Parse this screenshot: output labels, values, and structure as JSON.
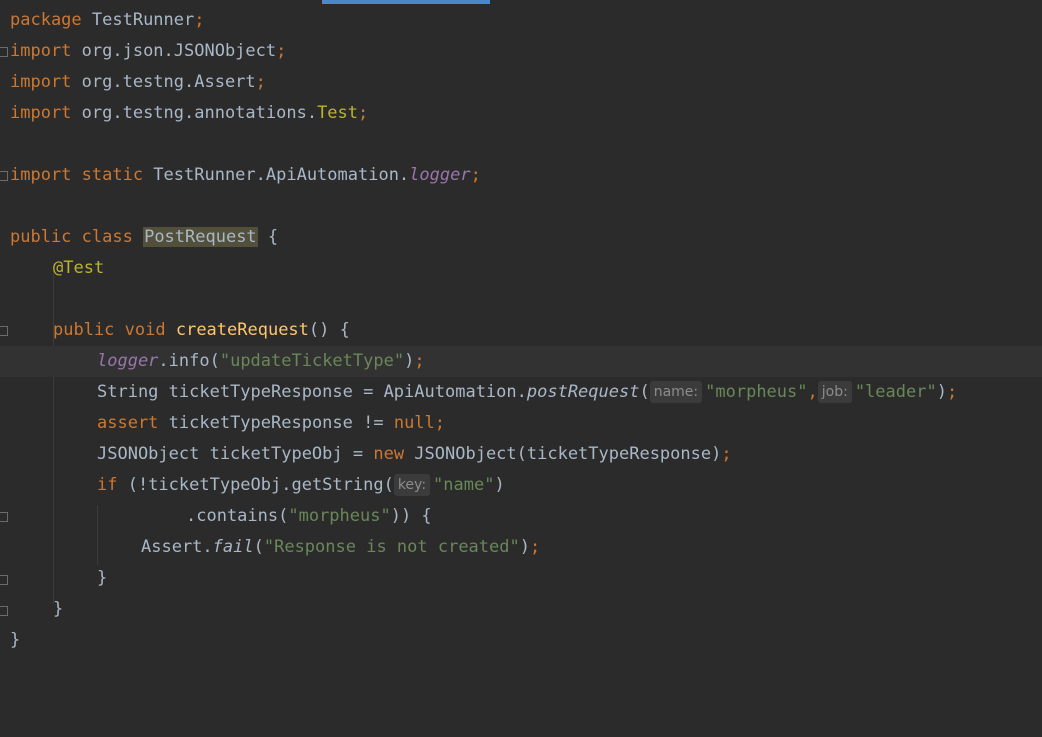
{
  "lines": {
    "l1": {
      "kw": "package",
      "rest": " TestRunner",
      "semi": ";"
    },
    "l2": {
      "kw": "import",
      "rest": " org.json.JSONObject",
      "semi": ";"
    },
    "l3": {
      "kw": "import",
      "rest": " org.testng.Assert",
      "semi": ";"
    },
    "l4": {
      "kw": "import",
      "rest": " org.testng.annotations.",
      "ann": "Test",
      "semi": ";"
    },
    "l6": {
      "kw": "import static",
      "rest": " TestRunner.ApiAutomation.",
      "field": "logger",
      "semi": ";"
    },
    "l8": {
      "kw": "public class",
      "space": " ",
      "cls": "PostRequest",
      "rest": " {"
    },
    "l9": {
      "ann": "@Test"
    },
    "l11": {
      "kw": "public void",
      "space": " ",
      "meth": "createRequest",
      "rest": "() {"
    },
    "l12": {
      "field": "logger",
      "a": ".info(",
      "str": "\"updateTicketType\"",
      "b": ")",
      "semi": ";"
    },
    "l13": {
      "a": "String ticketTypeResponse = ApiAutomation.",
      "call": "postRequest",
      "b": "(",
      "hint1": "name:",
      "str1": "\"morpheus\"",
      "comma": ",",
      "hint2": "job:",
      "str2": "\"leader\"",
      "c": ")",
      "semi": ";"
    },
    "l14": {
      "kw": "assert",
      "a": " ticketTypeResponse != ",
      "kw2": "null",
      "semi": ";"
    },
    "l15": {
      "a": "JSONObject ticketTypeObj = ",
      "kw": "new",
      "b": " JSONObject(ticketTypeResponse)",
      "semi": ";"
    },
    "l16": {
      "kw": "if",
      "a": " (!ticketTypeObj.getString(",
      "hint": "key:",
      "str": "\"name\"",
      "b": ")"
    },
    "l17": {
      "a": ".contains(",
      "str": "\"morpheus\"",
      "b": ")) {"
    },
    "l18": {
      "a": "Assert.",
      "call": "fail",
      "b": "(",
      "str": "\"Response is not created\"",
      "c": ")",
      "semi": ";"
    },
    "l19": {
      "a": "}"
    },
    "l20": {
      "a": "}"
    },
    "l21": {
      "a": "}"
    }
  }
}
